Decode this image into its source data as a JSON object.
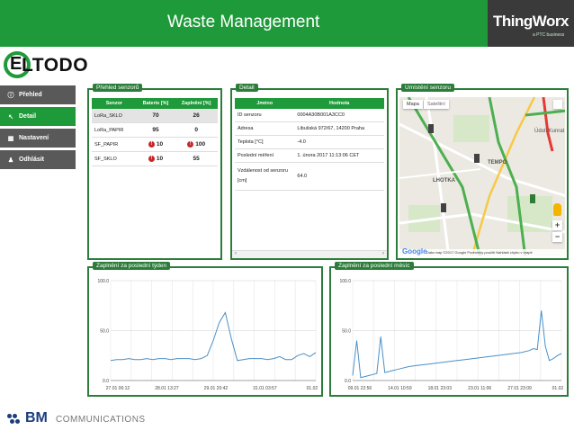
{
  "header": {
    "title": "Waste Management"
  },
  "brand": {
    "thingworx": "ThingWorx",
    "thingworx_sub": "a PTC business",
    "eltodo": "LTODO",
    "eltodo_initial": "E"
  },
  "sidebar": {
    "items": [
      {
        "label": "Přehled",
        "icon": "info-icon",
        "glyph": "ⓘ",
        "active": false
      },
      {
        "label": "Detail",
        "icon": "pointer-icon",
        "glyph": "↖",
        "active": true
      },
      {
        "label": "Nastavení",
        "icon": "settings-icon",
        "glyph": "▦",
        "active": false
      },
      {
        "label": "Odhlásit",
        "icon": "user-icon",
        "glyph": "♟",
        "active": false
      }
    ]
  },
  "overview": {
    "label": "Přehled senzorů",
    "headers": [
      "Senzor",
      "Baterie [%]",
      "Zaplnění [%]"
    ],
    "rows": [
      {
        "sensor": "LoRa_SKLO",
        "battery": "70",
        "fill": "26",
        "battery_warn": false,
        "fill_warn": false,
        "selected": true
      },
      {
        "sensor": "LoRa_PAPIR",
        "battery": "95",
        "fill": "0",
        "battery_warn": false,
        "fill_warn": false,
        "selected": false
      },
      {
        "sensor": "SF_PAPIR",
        "battery": "10",
        "fill": "100",
        "battery_warn": true,
        "fill_warn": true,
        "selected": false
      },
      {
        "sensor": "SF_SKLO",
        "battery": "10",
        "fill": "55",
        "battery_warn": true,
        "fill_warn": false,
        "selected": false
      }
    ],
    "colors": {
      "ok": "#1a8a1a",
      "warn": "#c62828"
    }
  },
  "detail": {
    "label": "Detail",
    "headers": [
      "Jméno",
      "Hodnota"
    ],
    "rows": [
      {
        "name": "ID senzoru",
        "value": "0004A30B001A3CC0"
      },
      {
        "name": "Adresa",
        "value": "Libušská 972/67, 14200 Praha"
      },
      {
        "name": "Teplota [°C]",
        "value": "-4.0"
      },
      {
        "name": "Poslední měření",
        "value": "1. února 2017 11:13:06 CET"
      },
      {
        "name": "Vzdálenost od senzoru [cm]",
        "value": "64.0"
      }
    ]
  },
  "map": {
    "label": "Umístění senzoru",
    "tab_map": "Mapa",
    "tab_satellite": "Satelitní",
    "places": [
      "LHOTKA",
      "TEMPO",
      "Údolí Kunrat"
    ],
    "footer": "Data map ©2017 Google    Podmínky použití    Nahlásit chybu v mapě",
    "google": "Google",
    "zoom_in": "+",
    "zoom_out": "−"
  },
  "charts": {
    "week": {
      "label": "Zaplnění za poslední týden",
      "yticks": [
        "100.0",
        "50.0",
        "0.0"
      ],
      "xticks": [
        "27.01 06:12",
        "28.01 13:27",
        "29.01 20:42",
        "31.01 03:57",
        "01.02 1"
      ]
    },
    "month": {
      "label": "Zaplnění za poslední měsíc",
      "yticks": [
        "100.0",
        "50.0",
        "0.0"
      ],
      "xticks": [
        "09.01 22:56",
        "14.01 10:59",
        "18.01 23:03",
        "23.01 11:06",
        "27.01 23:09",
        "01.02 1"
      ]
    }
  },
  "chart_data": [
    {
      "type": "line",
      "title": "Zaplnění za poslední týden",
      "ylim": [
        0,
        100
      ],
      "x": [
        0,
        0.5,
        1,
        1.5,
        2,
        2.5,
        3,
        3.5,
        4,
        4.5,
        5,
        5.5,
        6,
        6.5,
        7,
        7.5,
        8,
        8.5,
        9,
        9.5,
        10,
        10.5,
        11,
        11.5,
        12,
        12.5,
        13,
        13.5,
        14,
        14.5,
        15,
        15.5,
        16,
        16.5,
        17
      ],
      "series": [
        {
          "values": [
            20,
            21,
            21,
            22,
            21,
            21,
            22,
            21,
            22,
            22,
            21,
            22,
            22,
            22,
            21,
            22,
            25,
            40,
            58,
            68,
            42,
            20,
            21,
            22,
            22,
            22,
            21,
            22,
            24,
            21,
            21,
            25,
            27,
            24,
            28
          ]
        }
      ],
      "color": "#4a90c8"
    },
    {
      "type": "line",
      "title": "Zaplnění za poslední měsíc",
      "ylim": [
        0,
        100
      ],
      "x": [
        0,
        0.5,
        1,
        1.5,
        2,
        2.5,
        3,
        3.5,
        4,
        4.5,
        5,
        5.5,
        6,
        7,
        8,
        9,
        10,
        11,
        12,
        13,
        14,
        15,
        16,
        17,
        18,
        19,
        20,
        21,
        22,
        22.5,
        23,
        23.5,
        24,
        24.5,
        25,
        25.5,
        26
      ],
      "series": [
        {
          "values": [
            5,
            40,
            3,
            4,
            5,
            6,
            7,
            44,
            8,
            9,
            10,
            11,
            12,
            14,
            15,
            16,
            17,
            18,
            19,
            20,
            21,
            22,
            23,
            24,
            25,
            26,
            27,
            28,
            30,
            32,
            31,
            70,
            34,
            20,
            22,
            25,
            27
          ]
        }
      ],
      "color": "#4a90c8"
    }
  ]
}
